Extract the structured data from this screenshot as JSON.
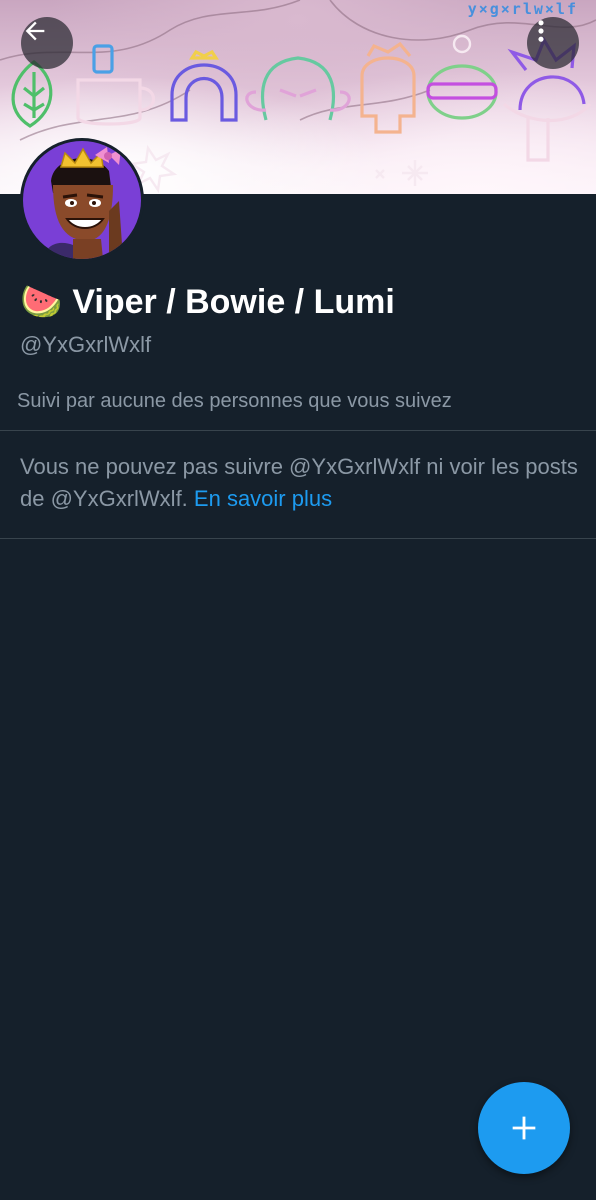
{
  "header": {
    "banner_tag": "y×g×rlw×lf",
    "back_icon": "arrow-left-icon",
    "more_icon": "vertical-dots-icon"
  },
  "profile": {
    "emoji": "🍉",
    "display_name": "Viper / Bowie / Lumi",
    "handle": "@YxGxrlWxlf",
    "followed_by": "Suivi par aucune des personnes que vous suivez"
  },
  "notice": {
    "text_part1": "Vous ne pouvez pas suivre @YxGxrlWxlf ni voir les posts de @YxGxrlWxlf.",
    "link": "En savoir plus"
  },
  "fab": {
    "icon": "plus-icon"
  },
  "colors": {
    "background": "#15202b",
    "accent": "#1d9bf0",
    "secondary_text": "#8b98a5",
    "divider": "#38444d"
  }
}
